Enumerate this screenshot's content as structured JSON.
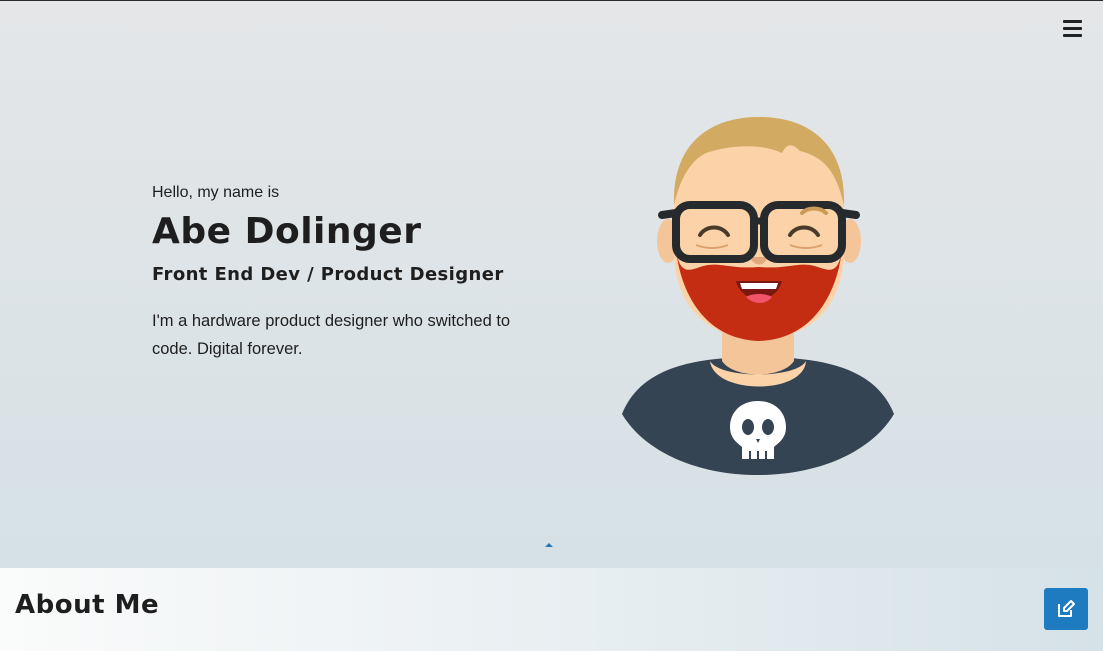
{
  "header": {
    "menu_icon": "hamburger-menu-icon"
  },
  "hero": {
    "greeting": "Hello, my name is",
    "name": "Abe Dolinger",
    "role": "Front End Dev / Product Designer",
    "tagline": "I'm a hardware product designer who switched to code. Digital forever.",
    "avatar_icon": "avatar-illustration",
    "scroll_icon": "caret-up-icon"
  },
  "about": {
    "title": "About Me",
    "edit_icon": "edit-icon"
  },
  "colors": {
    "accent": "#1f7bbf",
    "text": "#1e1e1e",
    "hero_bg_top": "#e4e6e8",
    "hero_bg_bottom": "#d5e1e6",
    "hair": "#d3aa62",
    "beard": "#c42d12",
    "skin": "#fcd2a8",
    "shirt": "#354452"
  }
}
